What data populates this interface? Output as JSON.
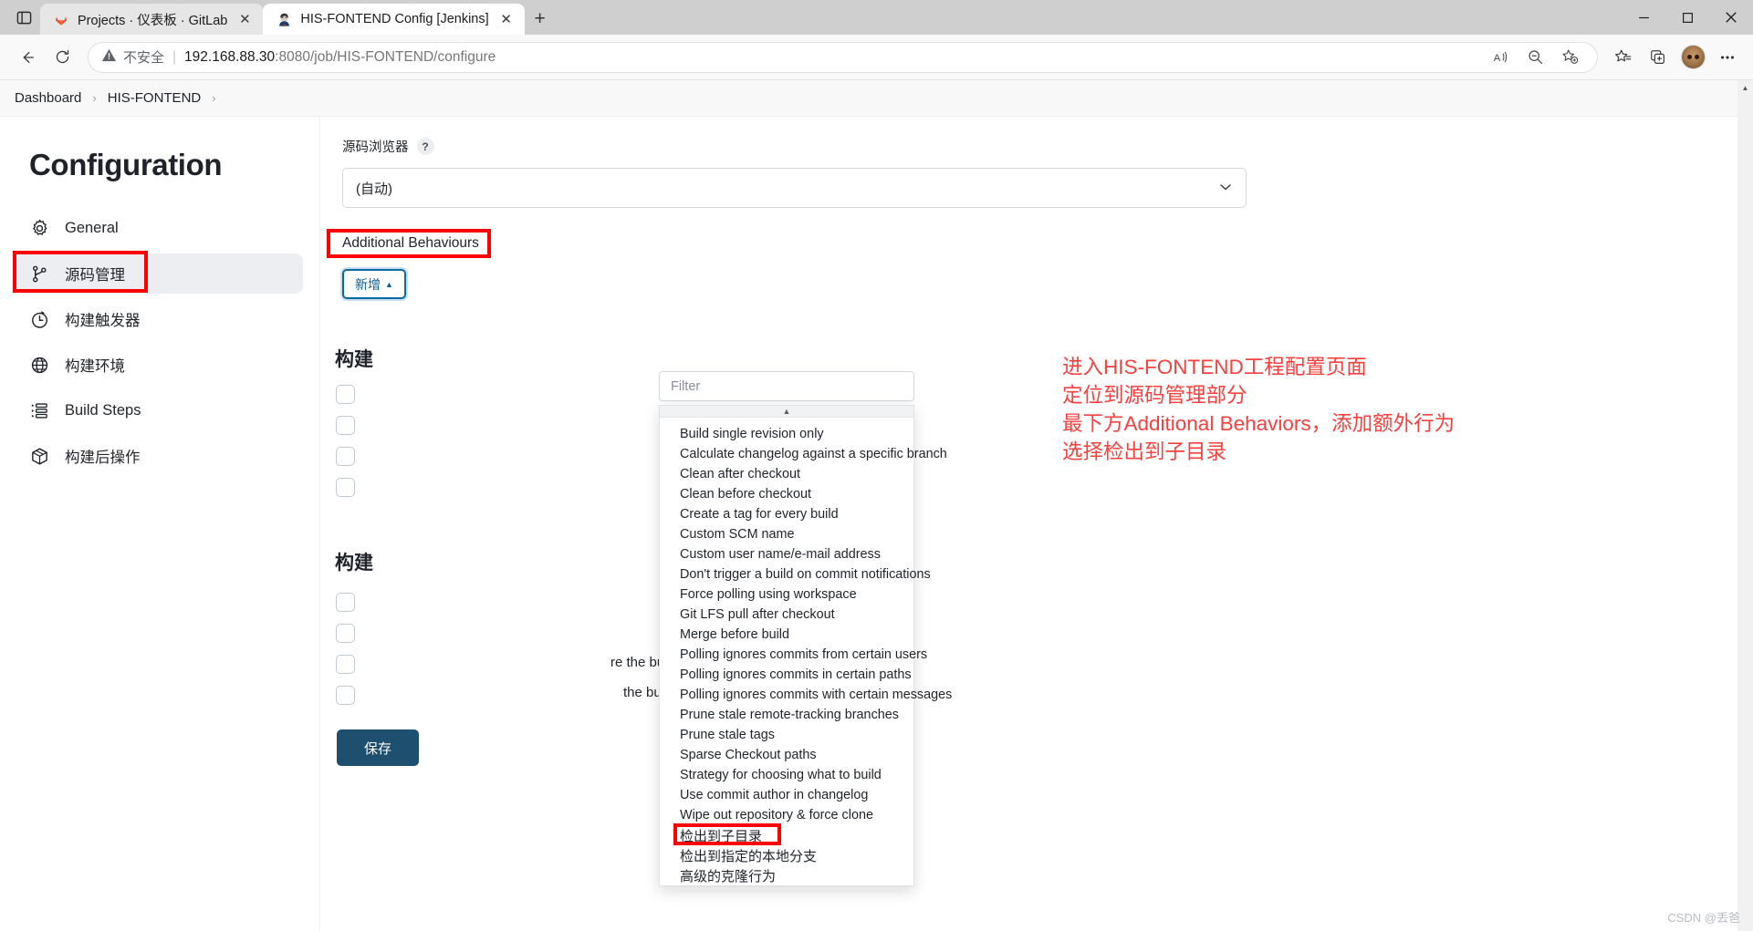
{
  "browser": {
    "tabs": [
      {
        "title": "Projects · 仪表板 · GitLab",
        "favicon": "gitlab-icon",
        "active": false,
        "close_label": "✕"
      },
      {
        "title": "HIS-FONTEND Config [Jenkins]",
        "favicon": "jenkins-icon",
        "active": true,
        "close_label": "✕"
      }
    ],
    "new_tab_label": "+",
    "tab_search_icon": "tab-list-icon",
    "window_controls": {
      "minimize": "—",
      "maximize": "▢",
      "close": "✕"
    },
    "toolbar": {
      "back_icon": "back-arrow-icon",
      "reload_icon": "reload-icon",
      "security_label": "不安全",
      "security_icon": "warning-triangle-icon",
      "separator": "|",
      "url_host": "192.168.88.30",
      "url_rest": ":8080/job/HIS-FONTEND/configure",
      "read_aloud_icon": "read-aloud-icon",
      "zoom_out_icon": "zoom-out-icon",
      "add_favorite_icon": "add-favorite-icon",
      "favorites_icon": "favorites-list-icon",
      "collections_icon": "collections-icon",
      "profile_icon": "avatar-icon",
      "settings_icon": "more-options-icon"
    }
  },
  "breadcrumb": {
    "items": [
      "Dashboard",
      "HIS-FONTEND"
    ],
    "separator": "›",
    "trailing_separator": "›"
  },
  "sidebar": {
    "title": "Configuration",
    "items": [
      {
        "label": "General",
        "icon": "gear-icon",
        "selected": false
      },
      {
        "label": "源码管理",
        "icon": "branch-icon",
        "selected": true
      },
      {
        "label": "构建触发器",
        "icon": "clock-icon",
        "selected": false
      },
      {
        "label": "构建环境",
        "icon": "globe-icon",
        "selected": false
      },
      {
        "label": "Build Steps",
        "icon": "list-steps-icon",
        "selected": false
      },
      {
        "label": "构建后操作",
        "icon": "box-icon",
        "selected": false
      }
    ]
  },
  "main": {
    "repo_browser_label": "源码浏览器",
    "help_badge": "?",
    "repo_browser_value": "(自动)",
    "select_caret": "⌄",
    "additional_behaviours_label": "Additional Behaviours",
    "add_button_label": "新增",
    "add_button_caret": "▲",
    "save_button_label": "保存",
    "background": {
      "section_a": "构建",
      "section_b": "构建",
      "text_before_build": "re the build starts",
      "text_build_runs": "the build runs",
      "help_badge": "?"
    }
  },
  "dropdown": {
    "filter_placeholder": "Filter",
    "scroll_up_icon": "▲",
    "items": [
      {
        "label": "Build single revision only",
        "highlighted": false
      },
      {
        "label": "Calculate changelog against a specific branch",
        "highlighted": false
      },
      {
        "label": "Clean after checkout",
        "highlighted": false
      },
      {
        "label": "Clean before checkout",
        "highlighted": false
      },
      {
        "label": "Create a tag for every build",
        "highlighted": false
      },
      {
        "label": "Custom SCM name",
        "highlighted": false
      },
      {
        "label": "Custom user name/e-mail address",
        "highlighted": false
      },
      {
        "label": "Don't trigger a build on commit notifications",
        "highlighted": false
      },
      {
        "label": "Force polling using workspace",
        "highlighted": false
      },
      {
        "label": "Git LFS pull after checkout",
        "highlighted": false
      },
      {
        "label": "Merge before build",
        "highlighted": false
      },
      {
        "label": "Polling ignores commits from certain users",
        "highlighted": false
      },
      {
        "label": "Polling ignores commits in certain paths",
        "highlighted": false
      },
      {
        "label": "Polling ignores commits with certain messages",
        "highlighted": false
      },
      {
        "label": "Prune stale remote-tracking branches",
        "highlighted": false
      },
      {
        "label": "Prune stale tags",
        "highlighted": false
      },
      {
        "label": "Sparse Checkout paths",
        "highlighted": false
      },
      {
        "label": "Strategy for choosing what to build",
        "highlighted": false
      },
      {
        "label": "Use commit author in changelog",
        "highlighted": false
      },
      {
        "label": "Wipe out repository & force clone",
        "highlighted": false
      },
      {
        "label": "检出到子目录",
        "highlighted": true
      },
      {
        "label": "检出到指定的本地分支",
        "highlighted": false
      },
      {
        "label": "高级的克隆行为",
        "highlighted": false
      }
    ]
  },
  "annotation": {
    "color": "#f8403e",
    "lines": [
      "进入HIS-FONTEND工程配置页面",
      "定位到源码管理部分",
      "最下方Additional Behaviors，添加额外行为",
      "选择检出到子目录"
    ]
  },
  "watermark": "CSDN @丢爸",
  "colors": {
    "annotation_red": "#f8403e",
    "highlight_box_red": "#fe0000",
    "accent_blue": "#0b5d91",
    "save_button": "#1f4f6e",
    "sidebar_selected": "#eceef1"
  }
}
